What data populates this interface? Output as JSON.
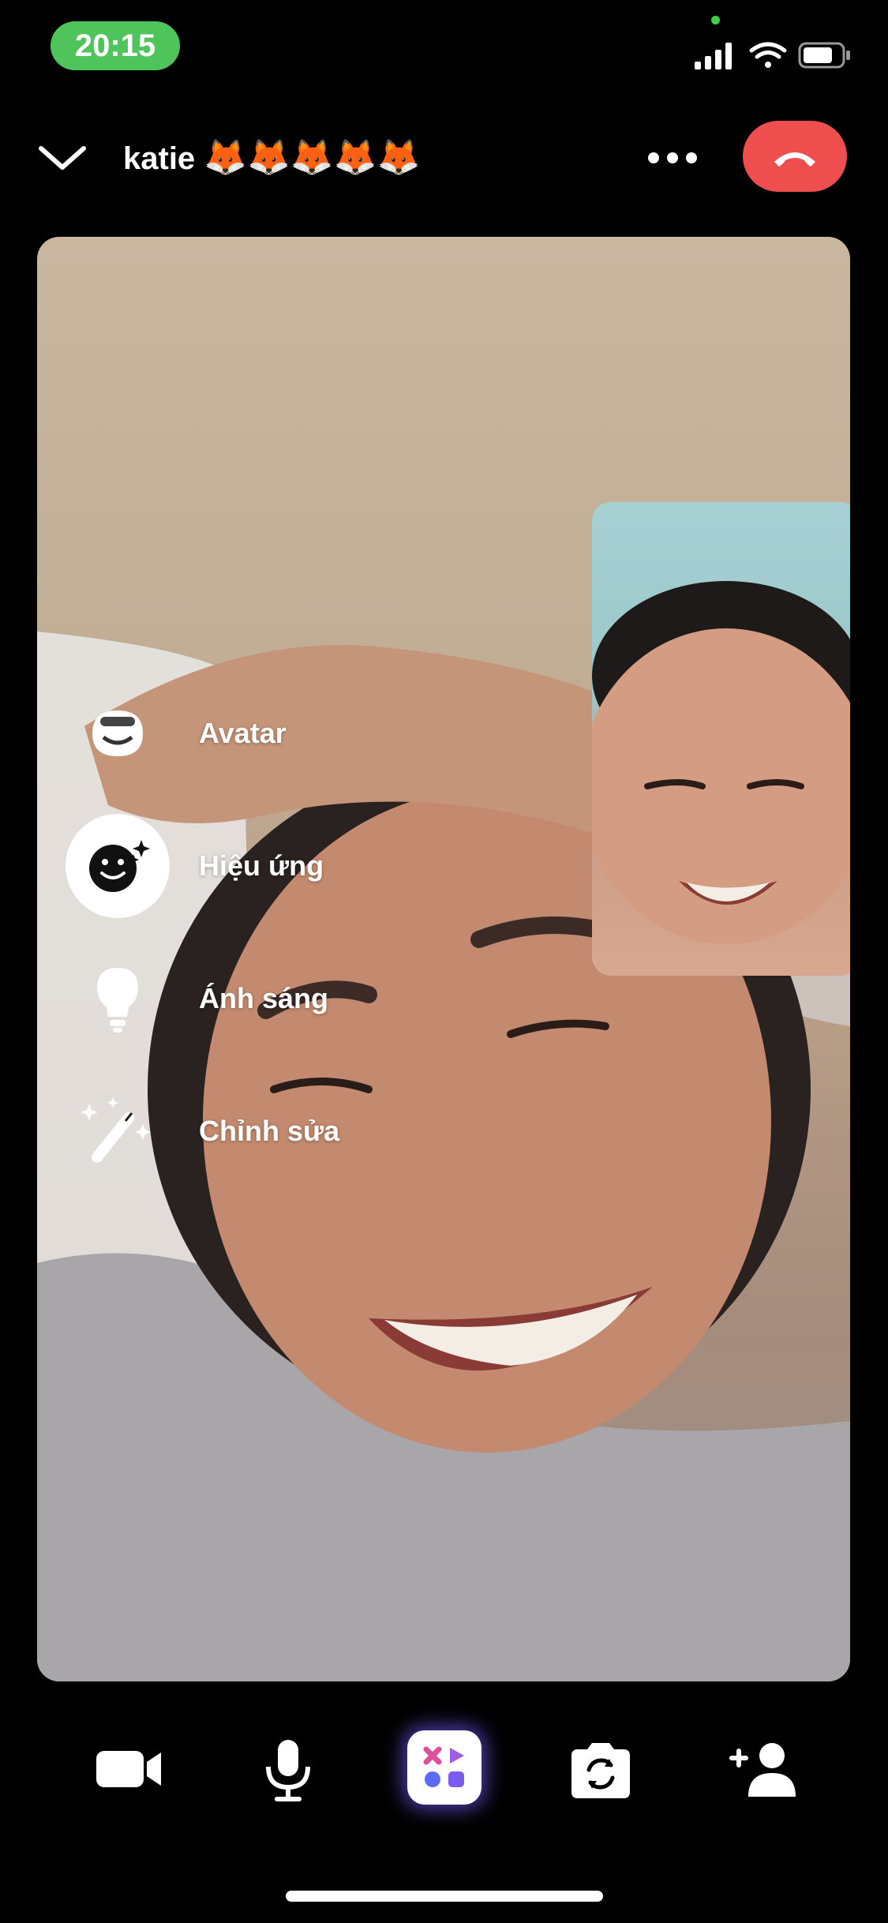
{
  "status_bar": {
    "time": "20:15"
  },
  "header": {
    "contact_name": "katie",
    "contact_emojis": "🦊🦊🦊🦊🦊"
  },
  "effects_menu": {
    "items": [
      {
        "label": "Avatar",
        "icon": "avatar-icon"
      },
      {
        "label": "Hiệu ứng",
        "icon": "smiley-sparkle-icon",
        "active": true
      },
      {
        "label": "Ánh sáng",
        "icon": "lightbulb-icon"
      },
      {
        "label": "Chỉnh sửa",
        "icon": "magic-wand-icon"
      }
    ]
  },
  "toolbar": {
    "buttons": [
      "video-camera-icon",
      "microphone-icon",
      "apps-icon",
      "flip-camera-icon",
      "add-person-icon"
    ]
  },
  "colors": {
    "status_pill": "#4fc45a",
    "end_call": "#ee4e4e",
    "apps_glow": "#785aff"
  }
}
